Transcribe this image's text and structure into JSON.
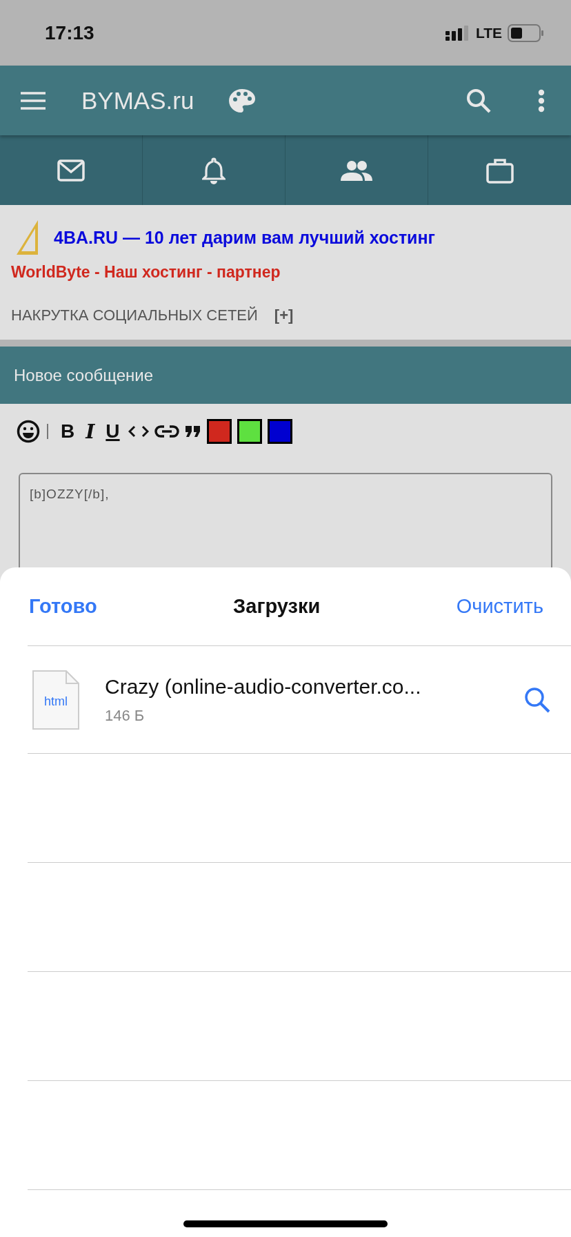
{
  "status_bar": {
    "time": "17:13",
    "network": "LTE"
  },
  "header": {
    "title": "BYMAS.ru"
  },
  "nav_tabs": [
    {
      "kind": "mail"
    },
    {
      "kind": "bell"
    },
    {
      "kind": "people"
    },
    {
      "kind": "briefcase"
    }
  ],
  "ads": [
    {
      "kind": "logo",
      "text": "4BA.RU — 10 лет дарим вам лучший хостинг",
      "color": "#0a0adc"
    },
    {
      "kind": "plain",
      "text": "WorldByte - Наш хостинг - партнер",
      "color": "#d0281e"
    }
  ],
  "promo": {
    "text": "НАКРУТКА СОЦИАЛЬНЫХ СЕТЕЙ",
    "toggle": "[+]"
  },
  "section_title": "Новое сообщение",
  "editor_toolbar": [
    {
      "kind": "emoji"
    },
    {
      "kind": "bold",
      "label": "B"
    },
    {
      "kind": "italic",
      "label": "I"
    },
    {
      "kind": "underline",
      "label": "U"
    },
    {
      "kind": "code"
    },
    {
      "kind": "link"
    },
    {
      "kind": "quote"
    },
    {
      "kind": "swatch",
      "color": "#d0281e"
    },
    {
      "kind": "swatch",
      "color": "#5ee040"
    },
    {
      "kind": "swatch",
      "color": "#0000d0"
    }
  ],
  "message": {
    "value": "[b]OZZY[/b],"
  },
  "downloads": {
    "done": "Готово",
    "title": "Загрузки",
    "clear": "Очистить",
    "items": [
      {
        "name": "Crazy (online-audio-converter.co...",
        "type": "html",
        "size": "146 Б"
      }
    ]
  }
}
